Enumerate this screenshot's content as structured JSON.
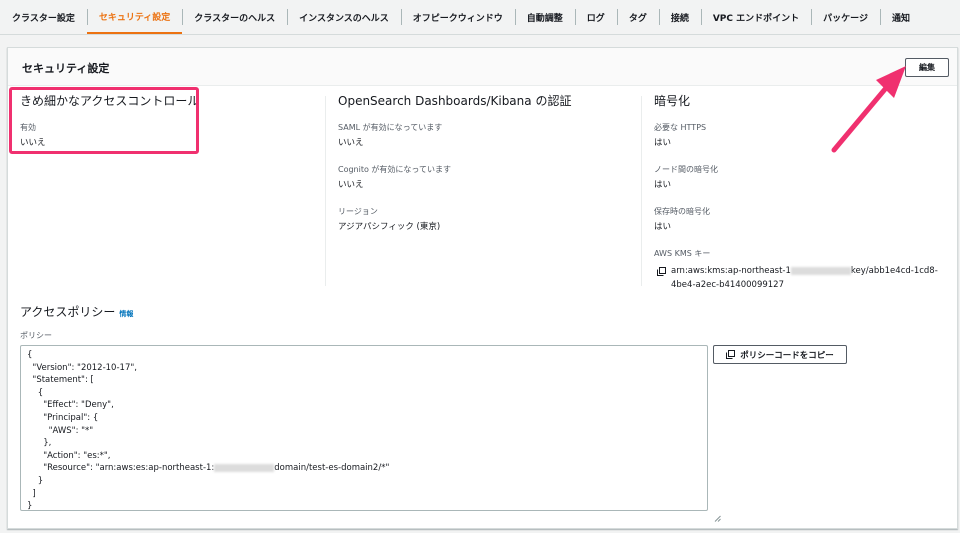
{
  "tabs": [
    {
      "label": "クラスター設定",
      "active": false
    },
    {
      "label": "セキュリティ設定",
      "active": true
    },
    {
      "label": "クラスターのヘルス",
      "active": false
    },
    {
      "label": "インスタンスのヘルス",
      "active": false
    },
    {
      "label": "オフピークウィンドウ",
      "active": false
    },
    {
      "label": "自動調整",
      "active": false
    },
    {
      "label": "ログ",
      "active": false
    },
    {
      "label": "タグ",
      "active": false
    },
    {
      "label": "接続",
      "active": false
    },
    {
      "label": "VPC エンドポイント",
      "active": false
    },
    {
      "label": "パッケージ",
      "active": false
    },
    {
      "label": "通知",
      "active": false
    }
  ],
  "panel": {
    "title": "セキュリティ設定",
    "edit_label": "編集"
  },
  "fine_grained": {
    "heading": "きめ細かなアクセスコントロール",
    "enabled_label": "有効",
    "enabled_value": "いいえ"
  },
  "opensearch_auth": {
    "heading": "OpenSearch Dashboards/Kibana の認証",
    "saml_label": "SAML が有効になっています",
    "saml_value": "いいえ",
    "cognito_label": "Cognito が有効になっています",
    "cognito_value": "いいえ",
    "region_label": "リージョン",
    "region_value": "アジアパシフィック (東京)"
  },
  "encryption": {
    "heading": "暗号化",
    "https_label": "必要な HTTPS",
    "https_value": "はい",
    "node_label": "ノード間の暗号化",
    "node_value": "はい",
    "rest_label": "保存時の暗号化",
    "rest_value": "はい",
    "kms_label": "AWS KMS キー",
    "kms_prefix": "arn:aws:kms:ap-northeast-1",
    "kms_suffix": "key/abb1e4cd-1cd8-4be4-a2ec-b41400099127"
  },
  "access_policy": {
    "heading": "アクセスポリシー",
    "info_link": "情報",
    "policy_label": "ポリシー",
    "copy_button": "ポリシーコードをコピー",
    "policy_text_before": "{\n  \"Version\": \"2012-10-17\",\n  \"Statement\": [\n    {\n      \"Effect\": \"Deny\",\n      \"Principal\": {\n        \"AWS\": \"*\"\n      },\n      \"Action\": \"es:*\",\n      \"Resource\": \"arn:aws:es:ap-northeast-1:",
    "policy_text_after": "domain/test-es-domain2/*\"\n    }\n  ]\n}"
  },
  "colors": {
    "accent": "#ec7211",
    "highlight": "#f0306f",
    "link": "#0073bb"
  }
}
